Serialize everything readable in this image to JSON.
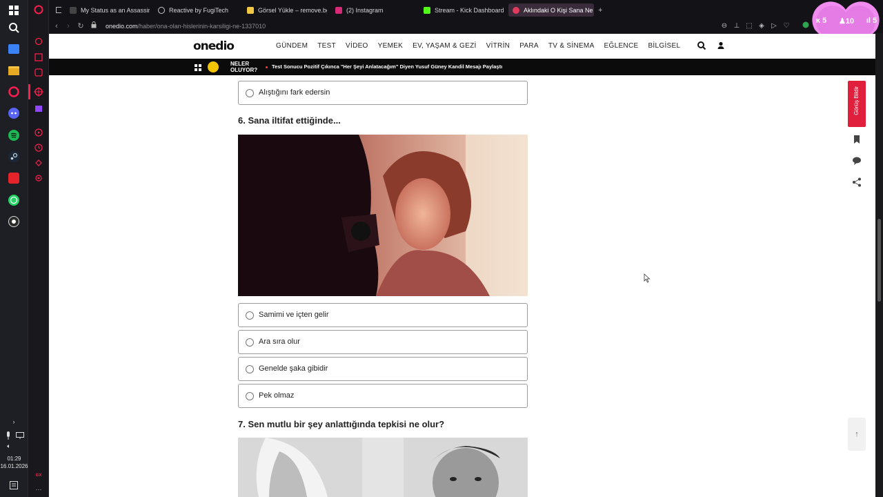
{
  "taskbar": {
    "time": "01:29",
    "date": "16.01.2026"
  },
  "browser": {
    "tabs": [
      {
        "label": "My Status as an Assassin",
        "color": "#222"
      },
      {
        "label": "Reactive by FugiTech",
        "color": "#222"
      },
      {
        "label": "Görsel Yükle – remove.bg",
        "color": "#f2c744"
      },
      {
        "label": "(2) Instagram",
        "color": "#d62976"
      },
      {
        "label": "Stream - Kick Dashboard",
        "color": "#53fc18"
      },
      {
        "label": "Aklındaki O Kişi Sana Ne H",
        "color": "#e03a5f"
      }
    ],
    "url_host": "onedio.com",
    "url_path": "/haber/ona-olan-hislerinin-karsiligi-ne-1337010"
  },
  "overlay": {
    "stat1": "5",
    "stat2": "10",
    "stat3": "5"
  },
  "site": {
    "logo": "onedio",
    "nav": [
      "GÜNDEM",
      "TEST",
      "VİDEO",
      "YEMEK",
      "EV, YAŞAM & GEZİ",
      "VİTRİN",
      "PARA",
      "TV & SİNEMA",
      "EĞLENCE",
      "BİLGİSEL"
    ],
    "ticker_label_1": "NELER",
    "ticker_label_2": "OLUYOR?",
    "ticker_headline": "Test Sonucu Pozitif Çıkınca \"Her Şeyi Anlatacağım\" Diyen Yusuf Güney Kandil Mesajı Paylaştı",
    "feedback_label": "Görüş Bildir"
  },
  "quiz": {
    "prev_option": "Alıştığını fark edersin",
    "q6_title": "6. Sana iltifat ettiğinde...",
    "q6_options": [
      "Samimi ve içten gelir",
      "Ara sıra olur",
      "Genelde şaka gibidir",
      "Pek olmaz"
    ],
    "q7_title": "7. Sen mutlu bir şey anlattığında tepkisi ne olur?"
  },
  "colors": {
    "accent": "#e01f3d",
    "ticker_bg": "#0b0b0b",
    "opera_red": "#fa1e4e"
  }
}
